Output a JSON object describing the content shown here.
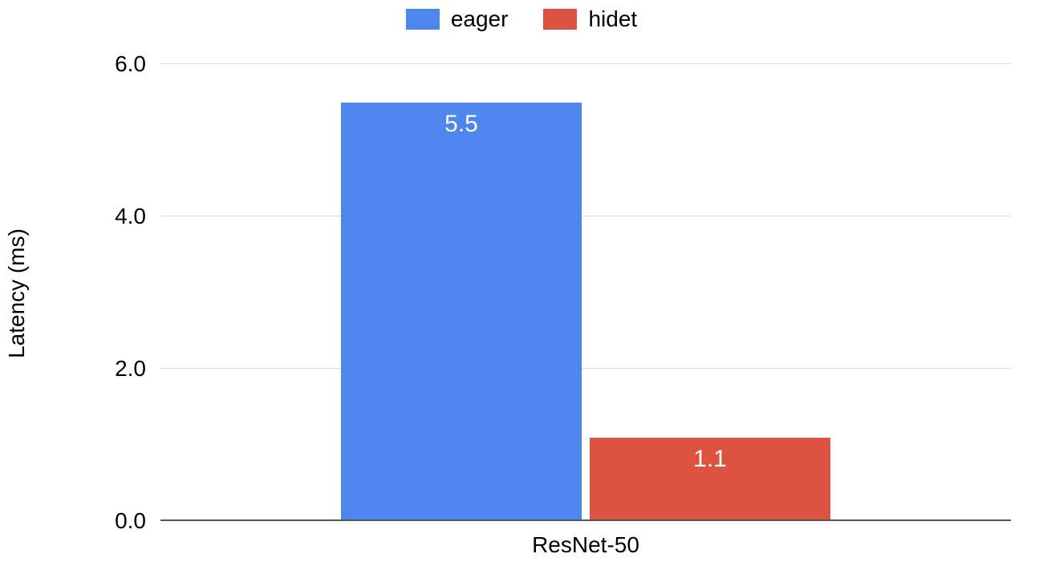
{
  "chart_data": {
    "type": "bar",
    "categories": [
      "ResNet-50"
    ],
    "series": [
      {
        "name": "eager",
        "values": [
          5.5
        ],
        "color": "#4f86ed"
      },
      {
        "name": "hidet",
        "values": [
          1.1
        ],
        "color": "#dc5341"
      }
    ],
    "ylabel": "Latency (ms)",
    "xlabel": "",
    "title": "",
    "ylim": [
      0.0,
      6.0
    ],
    "yticks": [
      "0.0",
      "2.0",
      "4.0",
      "6.0"
    ]
  }
}
